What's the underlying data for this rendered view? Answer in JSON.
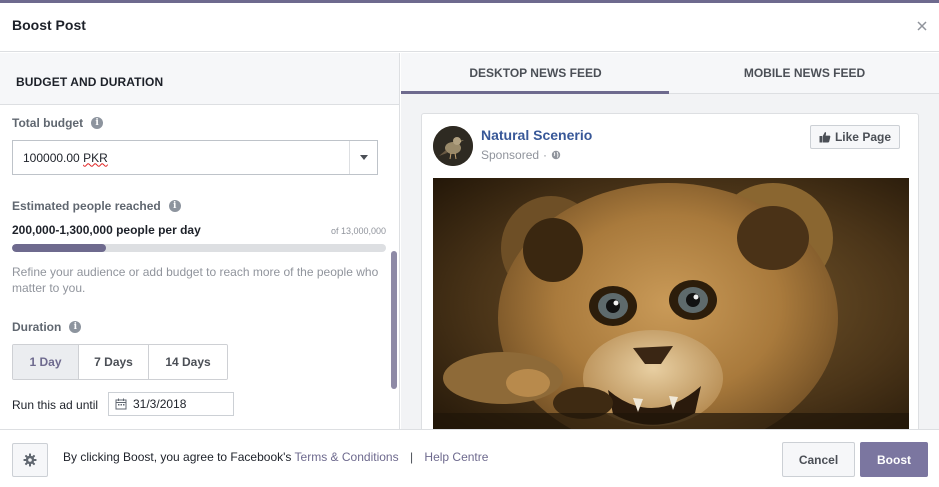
{
  "dialog": {
    "title": "Boost Post"
  },
  "left_panel": {
    "section_title": "BUDGET AND DURATION",
    "total_budget": {
      "label": "Total budget",
      "value": "100000.00",
      "currency": "PKR"
    },
    "reach": {
      "label": "Estimated people reached",
      "range_text": "200,000-1,300,000 people per day",
      "total_text": "of 13,000,000",
      "progress_fraction": 0.25,
      "hint": "Refine your audience or add budget to reach more of the people who matter to you."
    },
    "duration": {
      "label": "Duration",
      "options": [
        "1 Day",
        "7 Days",
        "14 Days"
      ],
      "selected": "1 Day"
    },
    "run_until": {
      "label": "Run this ad until",
      "date": "31/3/2018"
    }
  },
  "preview": {
    "tabs": [
      "DESKTOP NEWS FEED",
      "MOBILE NEWS FEED"
    ],
    "active_tab": "DESKTOP NEWS FEED",
    "post": {
      "page_name": "Natural Scenerio",
      "sponsored": "Sponsored",
      "like_button": "Like Page"
    }
  },
  "footer": {
    "terms_prefix": "By clicking Boost, you agree to Facebook's",
    "terms_link": "Terms & Conditions",
    "separator": "|",
    "help_link": "Help Centre",
    "cancel_label": "Cancel",
    "boost_label": "Boost"
  },
  "colors": {
    "accent": "#6e6a8e",
    "boost": "#7b76a0",
    "link": "#385898"
  },
  "icons": [
    "close-icon",
    "info-icon",
    "chevron-down-icon",
    "calendar-icon",
    "globe-icon",
    "thumbs-up-icon",
    "gear-icon"
  ]
}
